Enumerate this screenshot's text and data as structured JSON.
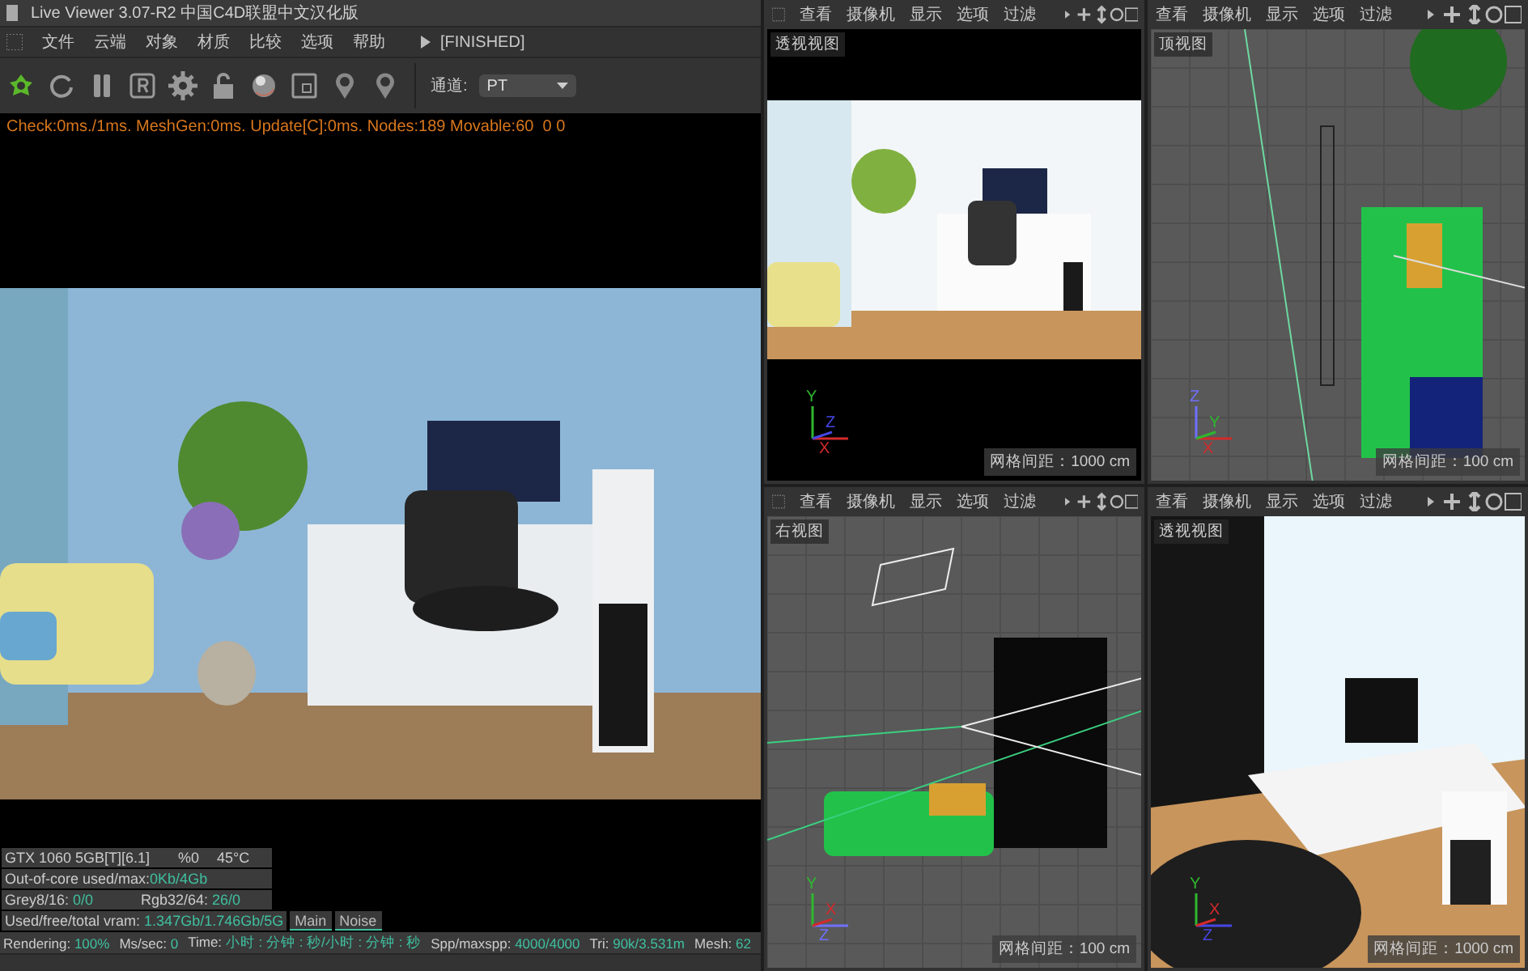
{
  "window": {
    "title": "Live Viewer 3.07-R2 中国C4D联盟中文汉化版"
  },
  "menu": [
    "文件",
    "云端",
    "对象",
    "材质",
    "比较",
    "选项",
    "帮助"
  ],
  "render_state": "[FINISHED]",
  "channel": {
    "label": "通道:",
    "value": "PT"
  },
  "info_line": "Check:0ms./1ms. MeshGen:0ms. Update[C]:0ms. Nodes:189 Movable:60  0 0",
  "gpu": {
    "name": "GTX 1060 5GB[T][6.1]",
    "load": "%0",
    "temperature": "45°C"
  },
  "stats": [
    {
      "label": "Out-of-core used/max:",
      "value": "0Kb/4Gb"
    },
    {
      "label": "Grey8/16: ",
      "value": "0/0",
      "label_2": "Rgb32/64: ",
      "value_2": "26/0"
    },
    {
      "label": "Used/free/total vram: ",
      "value": "1.347Gb/1.746Gb/5G"
    }
  ],
  "buttons": [
    "Main",
    "Noise"
  ],
  "status_bar": [
    {
      "label": "Rendering: ",
      "value": "100%"
    },
    {
      "label": "Ms/sec: ",
      "value": "0"
    },
    {
      "label": "Time: ",
      "value": "小时 : 分钟 : 秒/小时 : 分钟 : 秒"
    },
    {
      "label": "Spp/maxspp: ",
      "value": "4000/4000"
    },
    {
      "label": "Tri: ",
      "value": "90k/3.531m"
    },
    {
      "label": "Mesh: ",
      "value": "62"
    }
  ],
  "viewports": [
    {
      "kind": "render",
      "menu": [
        "查看",
        "摄像机",
        "显示",
        "选项",
        "过滤"
      ],
      "title": "透视视图",
      "grid_label": "网格间距：1000 cm",
      "axes": [
        {
          "label": "Y",
          "color": "#2eb82e"
        },
        {
          "label": "Z",
          "color": "#4646e6"
        },
        {
          "label": "X",
          "color": "#d42a2a"
        }
      ]
    },
    {
      "kind": "top",
      "menu": [
        "查看",
        "摄像机",
        "显示",
        "选项",
        "过滤"
      ],
      "title": "顶视图",
      "grid_label": "网格间距：100 cm",
      "axes": [
        {
          "label": "Z",
          "color": "#7070ff"
        },
        {
          "label": "Y",
          "color": "#2eb82e"
        },
        {
          "label": "X",
          "color": "#d42a2a"
        }
      ]
    },
    {
      "kind": "side",
      "menu": [
        "查看",
        "摄像机",
        "显示",
        "选项",
        "过滤"
      ],
      "title": "右视图",
      "grid_label": "网格间距：100 cm",
      "axes": [
        {
          "label": "Y",
          "color": "#2eb82e"
        },
        {
          "label": "X",
          "color": "#d42a2a"
        },
        {
          "label": "Z",
          "color": "#7070ff"
        }
      ]
    },
    {
      "kind": "shaded",
      "menu": [
        "查看",
        "摄像机",
        "显示",
        "选项",
        "过滤"
      ],
      "title": "透视视图",
      "grid_label": "网格间距：1000 cm",
      "axes": [
        {
          "label": "Y",
          "color": "#2eb82e"
        },
        {
          "label": "X",
          "color": "#d42a2a"
        },
        {
          "label": "Z",
          "color": "#4646e6"
        }
      ]
    }
  ]
}
